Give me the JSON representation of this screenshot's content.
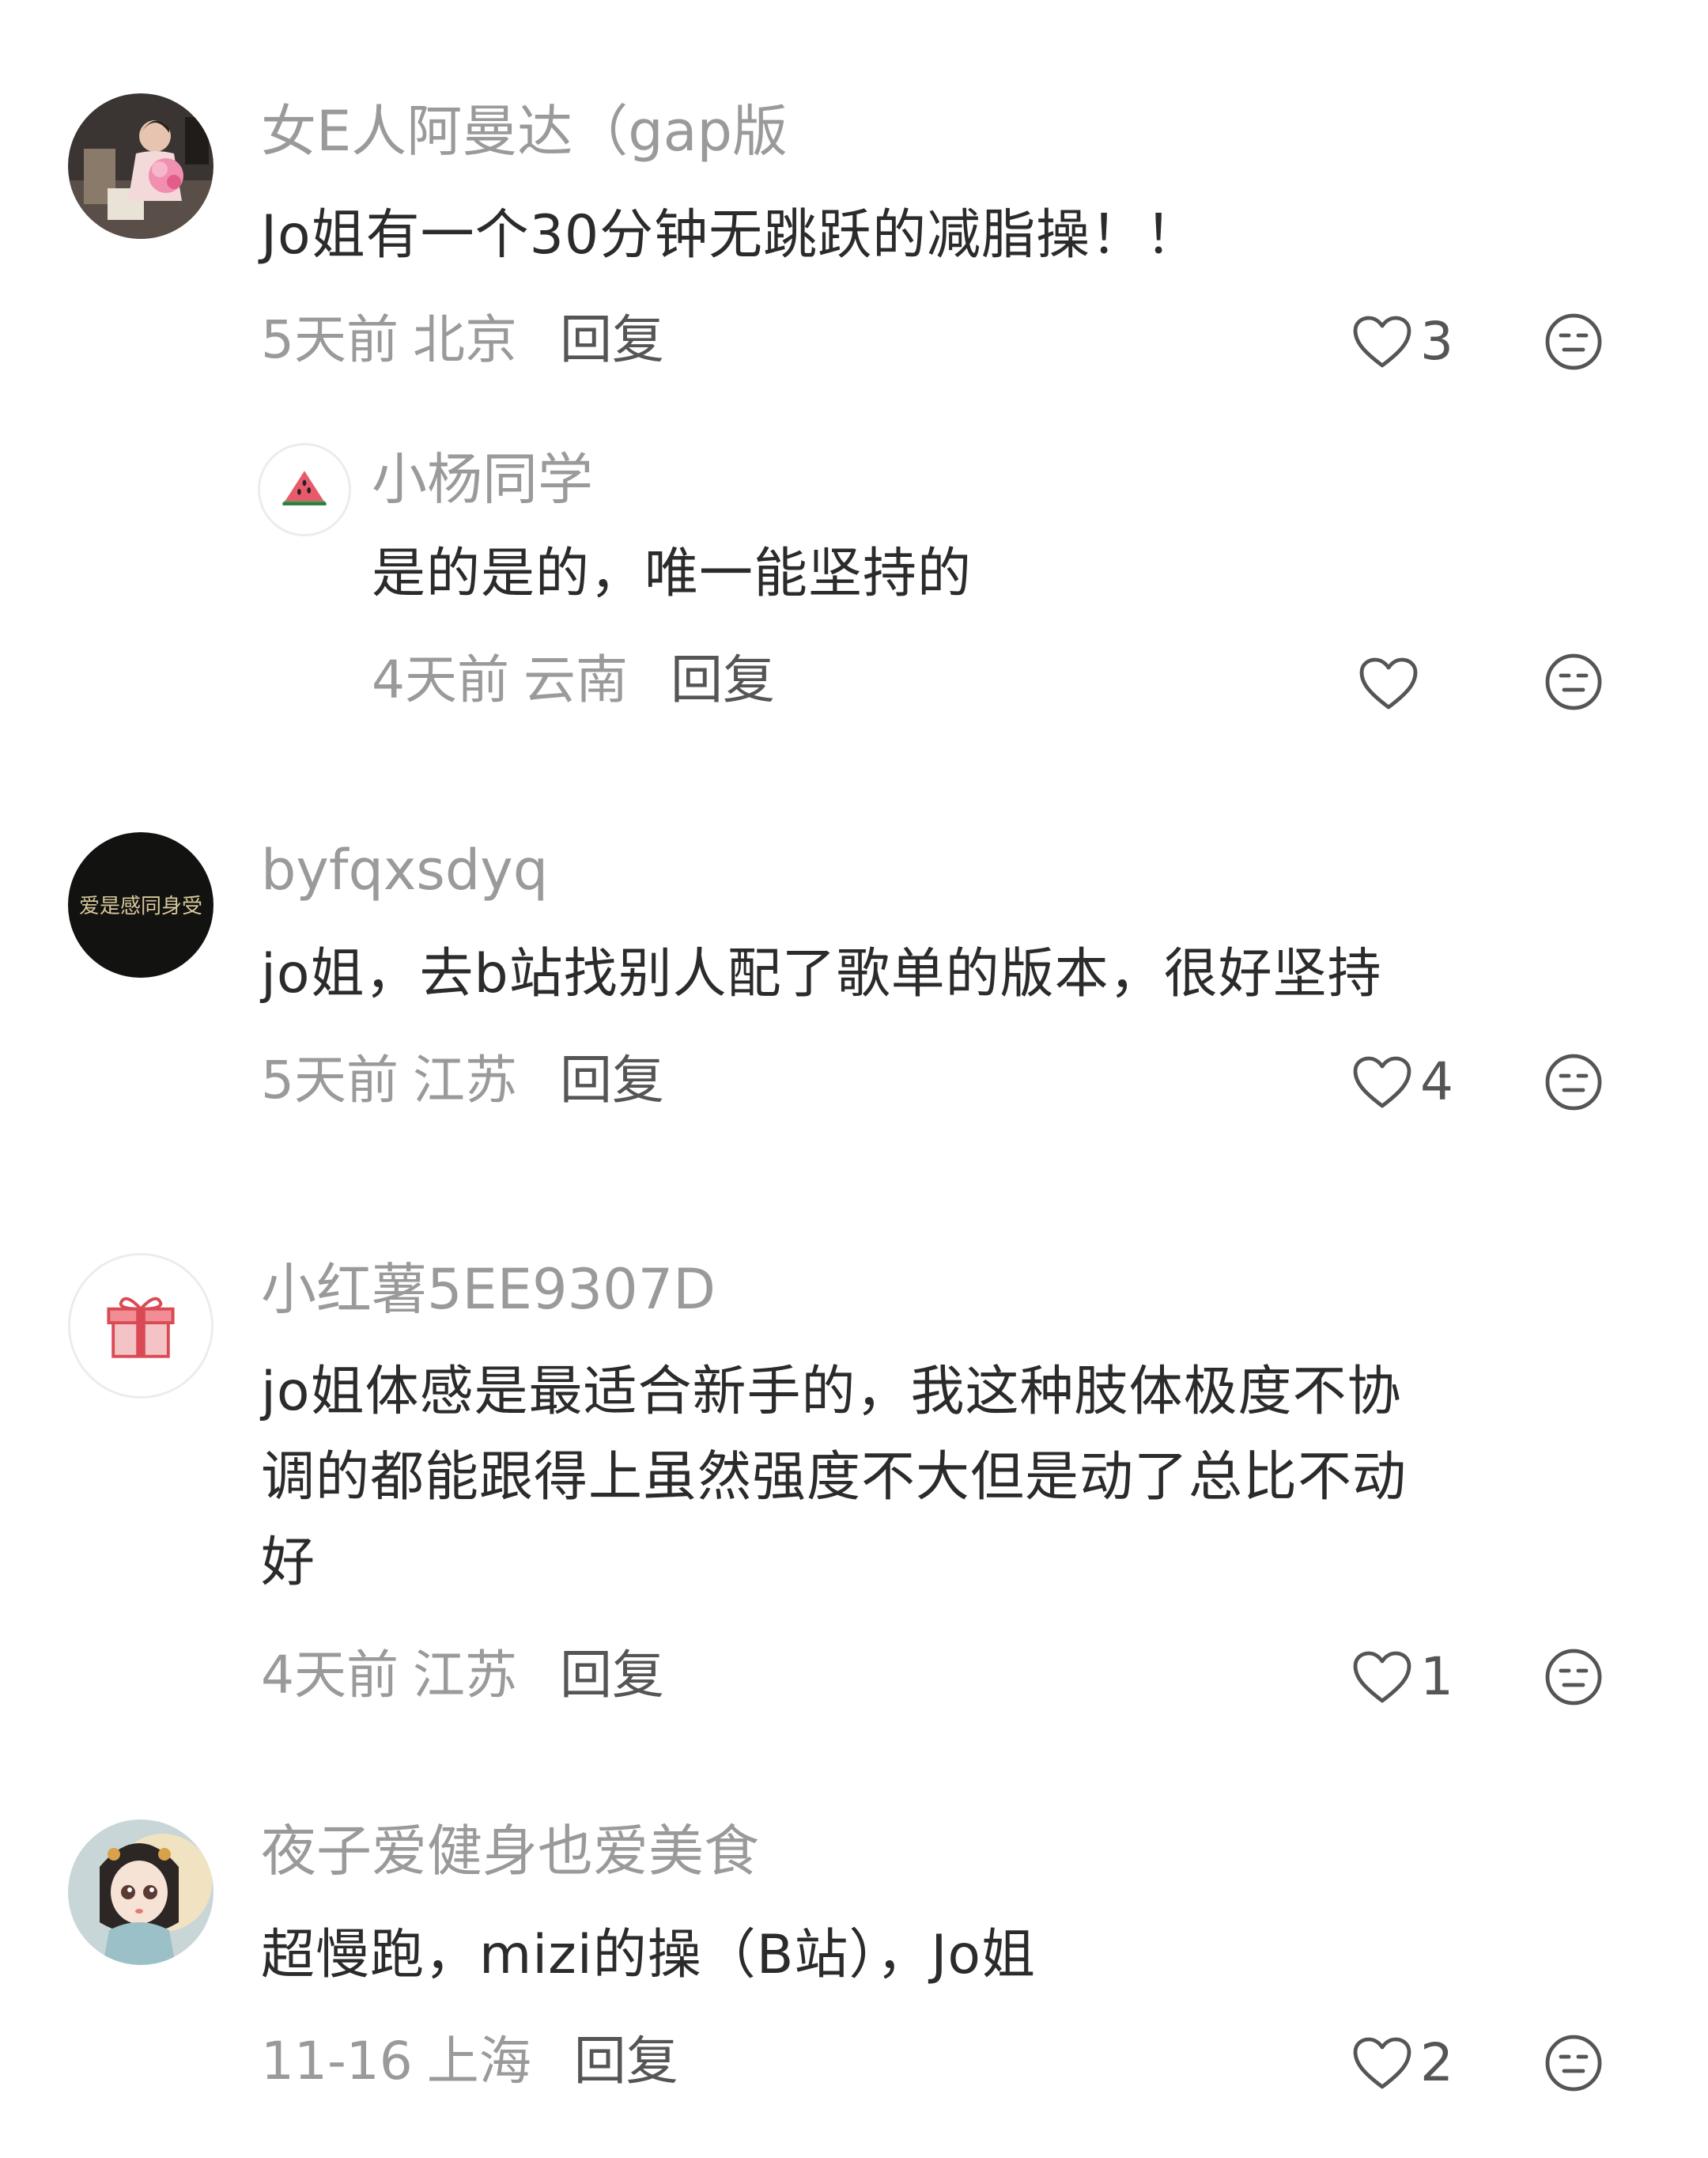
{
  "comments": [
    {
      "username": "女E人阿曼达（gap版",
      "content": "Jo姐有一个30分钟无跳跃的减脂操！！",
      "time": "5天前",
      "location": "北京",
      "reply_label": "回复",
      "likes": "3",
      "avatar_icon": "user-photo-avatar",
      "replies": [
        {
          "username": "小杨同学",
          "content": "是的是的，唯一能坚持的",
          "time": "4天前",
          "location": "云南",
          "reply_label": "回复",
          "likes": "",
          "avatar_icon": "watermelon-avatar"
        }
      ]
    },
    {
      "username": "byfqxsdyq",
      "content": "jo姐，去b站找别人配了歌单的版本，很好坚持",
      "time": "5天前",
      "location": "江苏",
      "reply_label": "回复",
      "likes": "4",
      "avatar_icon": "calligraphy-avatar",
      "avatar_text": "爱是感同身受"
    },
    {
      "username": "小红薯5EE9307D",
      "content": "jo姐体感是最适合新手的，我这种肢体极度不协\n调的都能跟得上虽然强度不大但是动了总比不动\n好",
      "time": "4天前",
      "location": "江苏",
      "reply_label": "回复",
      "likes": "1",
      "avatar_icon": "gift-avatar"
    },
    {
      "username": "夜子爱健身也爱美食",
      "content": "超慢跑，mizi的操（B站），Jo姐",
      "time": "11-16",
      "location": "上海",
      "reply_label": "回复",
      "likes": "2",
      "avatar_icon": "anime-girl-avatar"
    }
  ],
  "colors": {
    "username": "#9a9a9a",
    "content": "#2b2b2b",
    "meta": "#9a9a9a",
    "reply": "#555555",
    "icon": "#555555"
  }
}
